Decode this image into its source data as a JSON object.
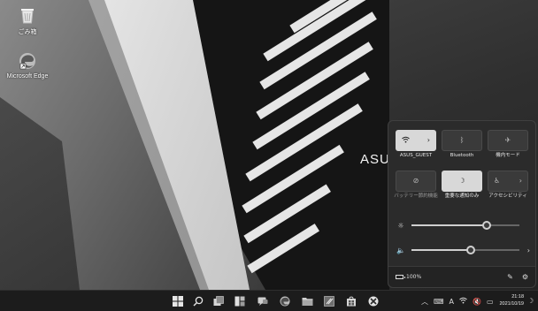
{
  "desktop": {
    "icons": [
      {
        "label": "ごみ箱",
        "icon": "recycle-bin-icon"
      },
      {
        "label": "Microsoft Edge",
        "icon": "edge-icon"
      }
    ],
    "wallpaper_text": "ASU"
  },
  "quick_settings": {
    "tiles": [
      {
        "label": "ASUS_GUEST",
        "icon": "wifi-icon",
        "active": true,
        "has_chevron": true
      },
      {
        "label": "Bluetooth",
        "icon": "bluetooth-icon",
        "active": false,
        "has_chevron": false
      },
      {
        "label": "機内モード",
        "icon": "airplane-icon",
        "active": false,
        "has_chevron": false
      },
      {
        "label": "バッテリー節約機能",
        "icon": "battery-saver-icon",
        "active": false,
        "has_chevron": false
      },
      {
        "label": "重要な通知のみ",
        "icon": "moon-icon",
        "active": true,
        "has_chevron": false
      },
      {
        "label": "アクセシビリティ",
        "icon": "accessibility-icon",
        "active": false,
        "has_chevron": true
      }
    ],
    "brightness_level": 0.7,
    "volume_level": 0.55,
    "battery": "100%"
  },
  "taskbar": {
    "apps": [
      "start-icon",
      "search-icon",
      "task-view-icon",
      "widgets-icon",
      "chat-icon",
      "edge-icon",
      "file-explorer-icon",
      "note-icon",
      "store-icon",
      "xbox-icon"
    ],
    "ime": "A",
    "time": "21:18",
    "date": "2021/10/19"
  }
}
